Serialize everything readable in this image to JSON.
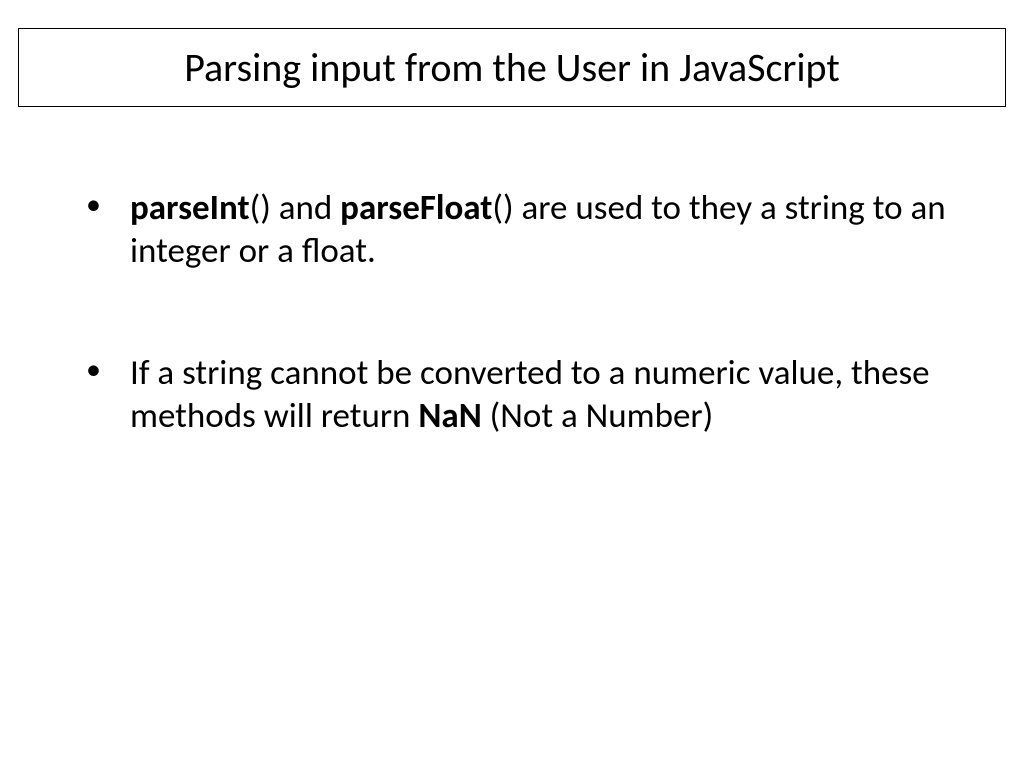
{
  "title": "Parsing input from the User in JavaScript",
  "bullets": [
    {
      "parts": [
        {
          "text": " ",
          "bold": false
        },
        {
          "text": "parseInt",
          "bold": true
        },
        {
          "text": "() and ",
          "bold": false
        },
        {
          "text": "parseFloat",
          "bold": true
        },
        {
          "text": "() are used to they a string to an integer or a float.",
          "bold": false
        }
      ]
    },
    {
      "parts": [
        {
          "text": " If a string cannot be converted to a numeric value, these methods will return ",
          "bold": false
        },
        {
          "text": "NaN",
          "bold": true
        },
        {
          "text": " (Not a Number)",
          "bold": false
        }
      ]
    }
  ]
}
